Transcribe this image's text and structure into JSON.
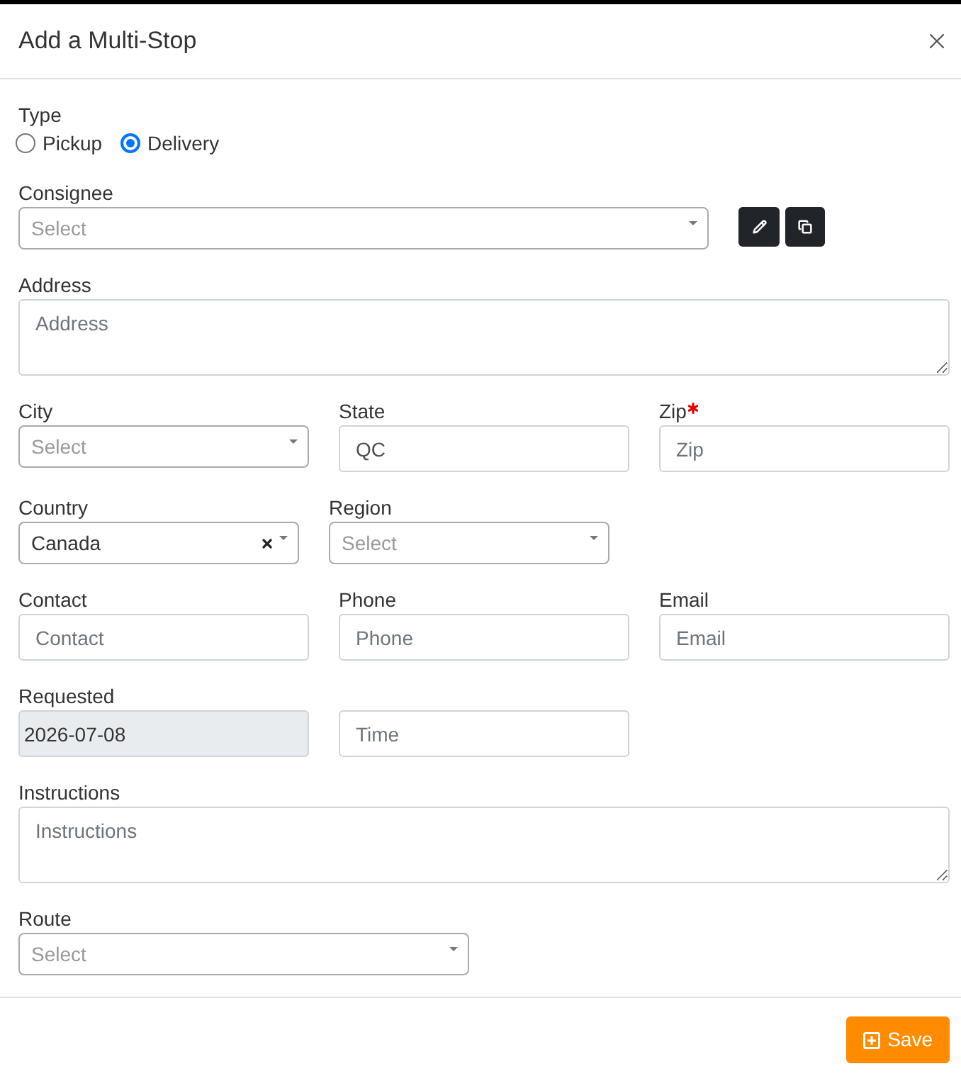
{
  "dialog": {
    "title": "Add a Multi-Stop"
  },
  "type": {
    "label": "Type",
    "options": [
      {
        "label": "Pickup",
        "selected": false
      },
      {
        "label": "Delivery",
        "selected": true
      }
    ]
  },
  "rows": [
    {
      "kind": "consignee",
      "fields": [
        {
          "kind": "select",
          "label": "Consignee",
          "placeholder": "Select",
          "required": false,
          "disabled": false
        }
      ]
    },
    {
      "kind": "full",
      "fields": [
        {
          "kind": "textarea",
          "label": "Address",
          "placeholder": "Address",
          "required": false,
          "disabled": false
        }
      ]
    },
    {
      "kind": "thirds",
      "fields": [
        {
          "kind": "select",
          "label": "City",
          "placeholder": "Select",
          "required": false,
          "disabled": false
        },
        {
          "kind": "input",
          "label": "State",
          "value": "QC",
          "required": false,
          "disabled": false
        },
        {
          "kind": "input",
          "label": "Zip",
          "placeholder": "Zip",
          "required": true,
          "disabled": false
        }
      ]
    },
    {
      "kind": "pair",
      "fields": [
        {
          "kind": "select",
          "label": "Country",
          "value": "Canada",
          "required": false,
          "disabled": false
        },
        {
          "kind": "select",
          "label": "Region",
          "placeholder": "Select",
          "required": false,
          "disabled": false
        }
      ]
    },
    {
      "kind": "thirds",
      "fields": [
        {
          "kind": "input",
          "label": "Contact",
          "placeholder": "Contact",
          "required": false,
          "disabled": false
        },
        {
          "kind": "input",
          "label": "Phone",
          "placeholder": "Phone",
          "required": false,
          "disabled": false
        },
        {
          "kind": "input",
          "label": "Email",
          "placeholder": "Email",
          "required": false,
          "disabled": false
        }
      ]
    },
    {
      "kind": "thirds",
      "fields": [
        {
          "kind": "input",
          "label": "Requested",
          "value": "2026-07-08",
          "required": false,
          "disabled": true
        },
        {
          "kind": "input",
          "placeholder": "Time",
          "required": false,
          "disabled": false
        }
      ]
    },
    {
      "kind": "full",
      "fields": [
        {
          "kind": "textarea",
          "label": "Instructions",
          "placeholder": "Instructions",
          "required": false,
          "disabled": false
        }
      ]
    },
    {
      "kind": "half",
      "fields": [
        {
          "kind": "select",
          "label": "Route",
          "placeholder": "Select",
          "required": false,
          "disabled": false
        }
      ]
    }
  ],
  "footer": {
    "save_button": "Save"
  }
}
